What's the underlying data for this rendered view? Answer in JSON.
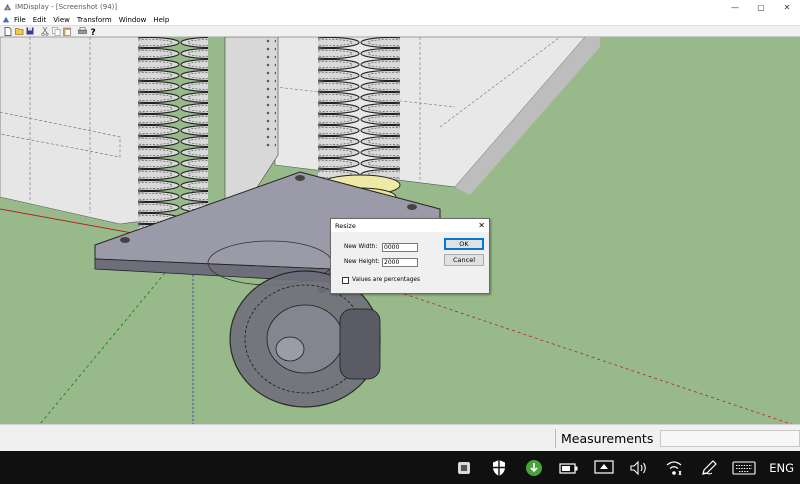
{
  "window": {
    "title": "IMDisplay - [Screenshot (94)]",
    "controls": {
      "minimize": "—",
      "maximize": "▢",
      "close": "✕"
    }
  },
  "menu": {
    "items": [
      "File",
      "Edit",
      "View",
      "Transform",
      "Window",
      "Help"
    ]
  },
  "toolbar": {
    "buttons": [
      "new-icon",
      "open-icon",
      "save-icon",
      "cut-icon",
      "copy-icon",
      "paste-icon",
      "print-icon",
      "help-icon"
    ]
  },
  "dialog": {
    "title": "Resize",
    "close": "✕",
    "width_label": "New Width:",
    "width_value": "0000",
    "height_label": "New Height:",
    "height_value": "2000",
    "ok_label": "OK",
    "cancel_label": "Cancel",
    "percent_label": "Values are percentages",
    "percent_checked": false
  },
  "statusbar": {
    "measurements_label": "Measurements",
    "measurements_value": ""
  },
  "taskbar": {
    "tray_icons": [
      "app-icon",
      "shield-icon",
      "torrent-icon",
      "battery-icon",
      "display-icon",
      "volume-icon",
      "wifi-icon",
      "pen-icon",
      "keyboard-icon"
    ],
    "language": "ENG"
  },
  "colors": {
    "viewport_ground": "#98ba8b",
    "accent": "#0078d7"
  }
}
